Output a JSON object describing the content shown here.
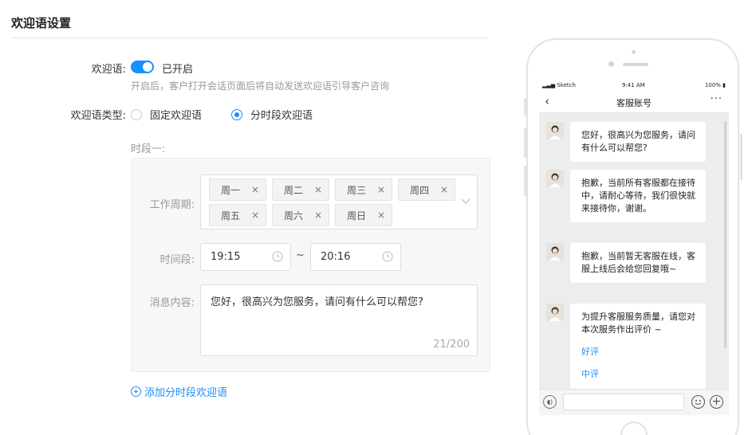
{
  "page": {
    "title": "欢迎语设置"
  },
  "welcome": {
    "label": "欢迎语:",
    "enabled": true,
    "state_text": "已开启",
    "hint": "开启后，客户打开会话页面后将自动发送欢迎语引导客户咨询"
  },
  "type": {
    "label": "欢迎语类型:",
    "options": [
      {
        "label": "固定欢迎语",
        "checked": false
      },
      {
        "label": "分时段欢迎语",
        "checked": true
      }
    ]
  },
  "period": {
    "title": "时段一:",
    "cycle_label": "工作周期:",
    "days": [
      {
        "label": "周一",
        "close": "×"
      },
      {
        "label": "周二",
        "close": "×"
      },
      {
        "label": "周三",
        "close": "×"
      },
      {
        "label": "周四",
        "close": "×"
      },
      {
        "label": "周五",
        "close": "×"
      },
      {
        "label": "周六",
        "close": "×"
      },
      {
        "label": "周日",
        "close": "×"
      }
    ],
    "time_label": "时间段:",
    "start_time": "19:15",
    "end_time": "20:16",
    "separator": "~",
    "message_label": "消息内容:",
    "message": "您好，很高兴为您服务，请问有什么可以帮您?",
    "char_count": "21/200"
  },
  "add_period": {
    "label": "添加分时段欢迎语"
  },
  "phone": {
    "status": {
      "carrier": "Sketch",
      "time": "9:41 AM",
      "battery": "100%"
    },
    "nav": {
      "back": "‹",
      "title": "客服账号",
      "more": "···"
    },
    "messages": [
      {
        "text": "您好，很高兴为您服务，请问有什么可以帮您?"
      },
      {
        "text": "抱歉，当前所有客服都在接待中，请耐心等待，我们很快就来接待你，谢谢。"
      },
      {
        "text": "抱歉，当前暂无客服在线，客服上线后会给您回复哦~"
      },
      {
        "text": "为提升客服服务质量，请您对本次服务作出评价 ~",
        "links": [
          "好评",
          "中评"
        ]
      }
    ]
  },
  "colors": {
    "accent": "#1890ff",
    "panel": "#f7f7f7",
    "chat_bg": "#ededed"
  }
}
